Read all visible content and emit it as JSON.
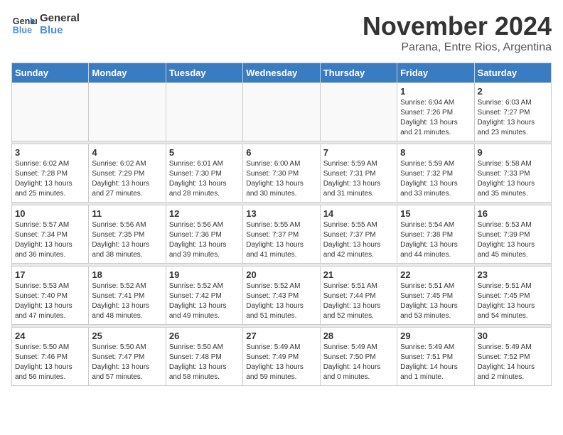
{
  "header": {
    "logo_line1": "General",
    "logo_line2": "Blue",
    "month": "November 2024",
    "location": "Parana, Entre Rios, Argentina"
  },
  "weekdays": [
    "Sunday",
    "Monday",
    "Tuesday",
    "Wednesday",
    "Thursday",
    "Friday",
    "Saturday"
  ],
  "weeks": [
    [
      {
        "day": "",
        "info": ""
      },
      {
        "day": "",
        "info": ""
      },
      {
        "day": "",
        "info": ""
      },
      {
        "day": "",
        "info": ""
      },
      {
        "day": "",
        "info": ""
      },
      {
        "day": "1",
        "info": "Sunrise: 6:04 AM\nSunset: 7:26 PM\nDaylight: 13 hours\nand 21 minutes."
      },
      {
        "day": "2",
        "info": "Sunrise: 6:03 AM\nSunset: 7:27 PM\nDaylight: 13 hours\nand 23 minutes."
      }
    ],
    [
      {
        "day": "3",
        "info": "Sunrise: 6:02 AM\nSunset: 7:28 PM\nDaylight: 13 hours\nand 25 minutes."
      },
      {
        "day": "4",
        "info": "Sunrise: 6:02 AM\nSunset: 7:29 PM\nDaylight: 13 hours\nand 27 minutes."
      },
      {
        "day": "5",
        "info": "Sunrise: 6:01 AM\nSunset: 7:30 PM\nDaylight: 13 hours\nand 28 minutes."
      },
      {
        "day": "6",
        "info": "Sunrise: 6:00 AM\nSunset: 7:30 PM\nDaylight: 13 hours\nand 30 minutes."
      },
      {
        "day": "7",
        "info": "Sunrise: 5:59 AM\nSunset: 7:31 PM\nDaylight: 13 hours\nand 31 minutes."
      },
      {
        "day": "8",
        "info": "Sunrise: 5:59 AM\nSunset: 7:32 PM\nDaylight: 13 hours\nand 33 minutes."
      },
      {
        "day": "9",
        "info": "Sunrise: 5:58 AM\nSunset: 7:33 PM\nDaylight: 13 hours\nand 35 minutes."
      }
    ],
    [
      {
        "day": "10",
        "info": "Sunrise: 5:57 AM\nSunset: 7:34 PM\nDaylight: 13 hours\nand 36 minutes."
      },
      {
        "day": "11",
        "info": "Sunrise: 5:56 AM\nSunset: 7:35 PM\nDaylight: 13 hours\nand 38 minutes."
      },
      {
        "day": "12",
        "info": "Sunrise: 5:56 AM\nSunset: 7:36 PM\nDaylight: 13 hours\nand 39 minutes."
      },
      {
        "day": "13",
        "info": "Sunrise: 5:55 AM\nSunset: 7:37 PM\nDaylight: 13 hours\nand 41 minutes."
      },
      {
        "day": "14",
        "info": "Sunrise: 5:55 AM\nSunset: 7:37 PM\nDaylight: 13 hours\nand 42 minutes."
      },
      {
        "day": "15",
        "info": "Sunrise: 5:54 AM\nSunset: 7:38 PM\nDaylight: 13 hours\nand 44 minutes."
      },
      {
        "day": "16",
        "info": "Sunrise: 5:53 AM\nSunset: 7:39 PM\nDaylight: 13 hours\nand 45 minutes."
      }
    ],
    [
      {
        "day": "17",
        "info": "Sunrise: 5:53 AM\nSunset: 7:40 PM\nDaylight: 13 hours\nand 47 minutes."
      },
      {
        "day": "18",
        "info": "Sunrise: 5:52 AM\nSunset: 7:41 PM\nDaylight: 13 hours\nand 48 minutes."
      },
      {
        "day": "19",
        "info": "Sunrise: 5:52 AM\nSunset: 7:42 PM\nDaylight: 13 hours\nand 49 minutes."
      },
      {
        "day": "20",
        "info": "Sunrise: 5:52 AM\nSunset: 7:43 PM\nDaylight: 13 hours\nand 51 minutes."
      },
      {
        "day": "21",
        "info": "Sunrise: 5:51 AM\nSunset: 7:44 PM\nDaylight: 13 hours\nand 52 minutes."
      },
      {
        "day": "22",
        "info": "Sunrise: 5:51 AM\nSunset: 7:45 PM\nDaylight: 13 hours\nand 53 minutes."
      },
      {
        "day": "23",
        "info": "Sunrise: 5:51 AM\nSunset: 7:45 PM\nDaylight: 13 hours\nand 54 minutes."
      }
    ],
    [
      {
        "day": "24",
        "info": "Sunrise: 5:50 AM\nSunset: 7:46 PM\nDaylight: 13 hours\nand 56 minutes."
      },
      {
        "day": "25",
        "info": "Sunrise: 5:50 AM\nSunset: 7:47 PM\nDaylight: 13 hours\nand 57 minutes."
      },
      {
        "day": "26",
        "info": "Sunrise: 5:50 AM\nSunset: 7:48 PM\nDaylight: 13 hours\nand 58 minutes."
      },
      {
        "day": "27",
        "info": "Sunrise: 5:49 AM\nSunset: 7:49 PM\nDaylight: 13 hours\nand 59 minutes."
      },
      {
        "day": "28",
        "info": "Sunrise: 5:49 AM\nSunset: 7:50 PM\nDaylight: 14 hours\nand 0 minutes."
      },
      {
        "day": "29",
        "info": "Sunrise: 5:49 AM\nSunset: 7:51 PM\nDaylight: 14 hours\nand 1 minute."
      },
      {
        "day": "30",
        "info": "Sunrise: 5:49 AM\nSunset: 7:52 PM\nDaylight: 14 hours\nand 2 minutes."
      }
    ]
  ]
}
